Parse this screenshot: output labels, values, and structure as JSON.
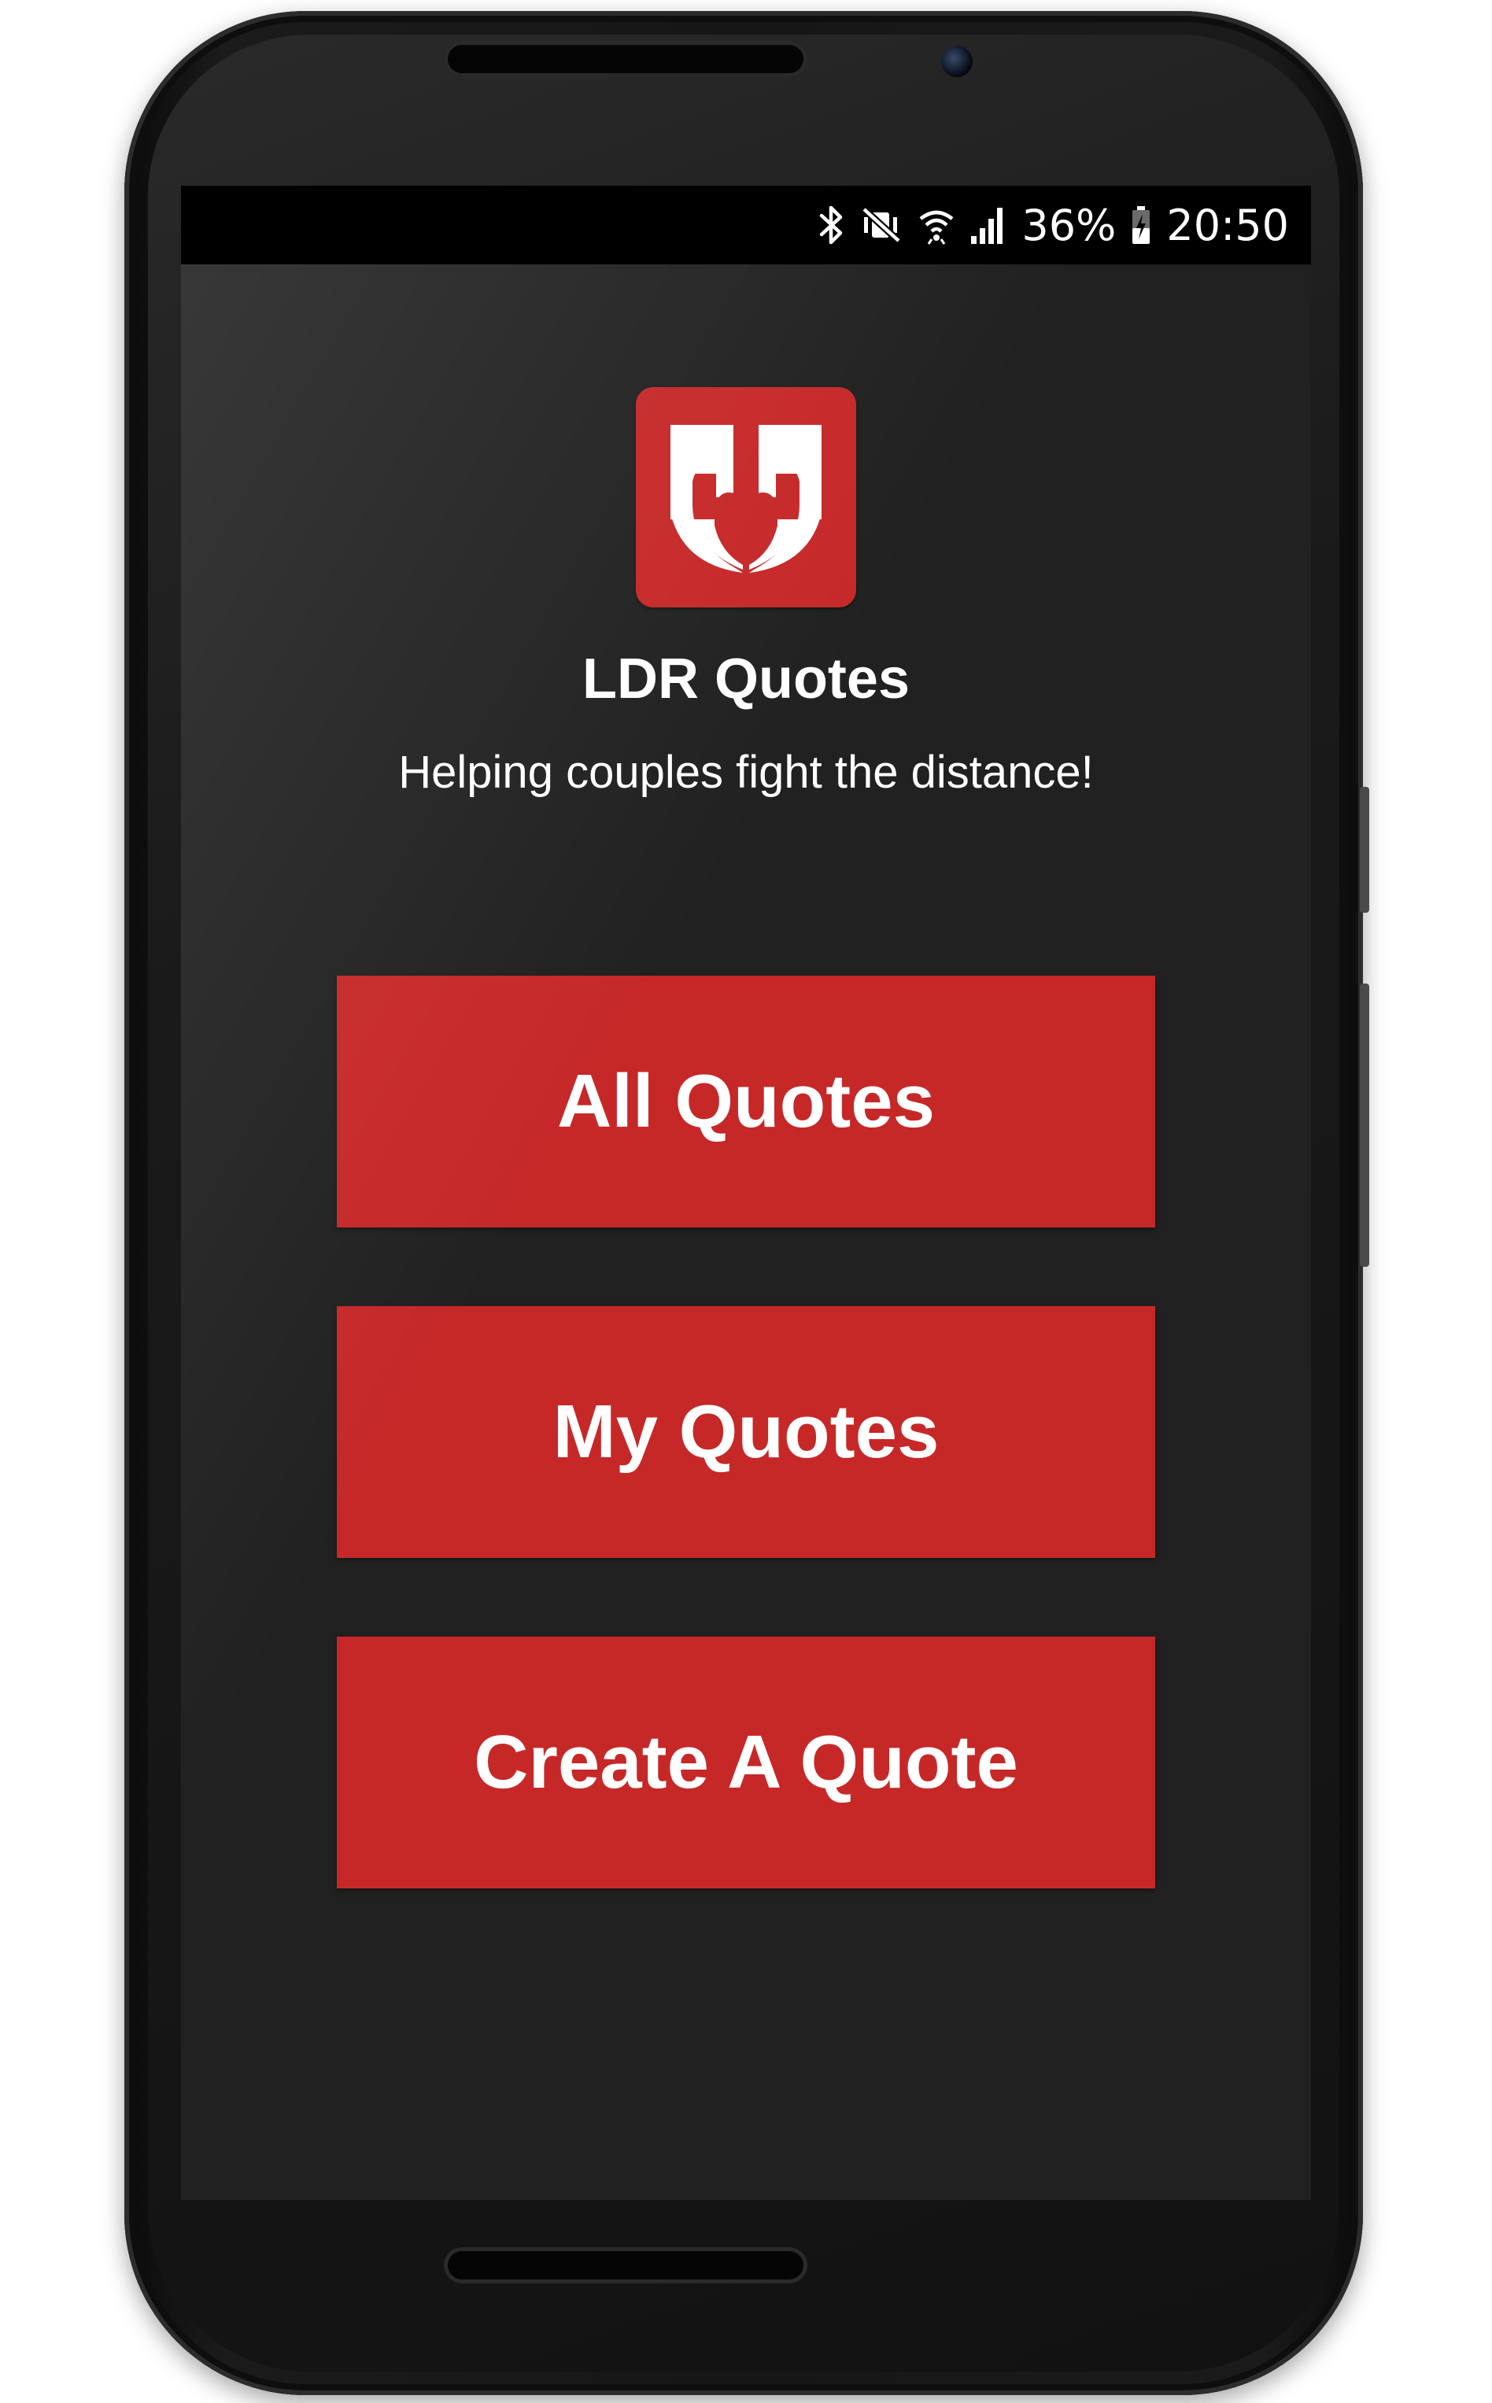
{
  "status_bar": {
    "battery_percent": "36%",
    "time": "20:50",
    "icons": [
      "bluetooth-icon",
      "vibrate-mute-icon",
      "wifi-icon",
      "signal-icon",
      "battery-charging-icon"
    ]
  },
  "app": {
    "title": "LDR Quotes",
    "tagline": "Helping couples fight the distance!",
    "logo_icon": "quote-heart-logo-icon"
  },
  "menu": {
    "all_quotes": "All Quotes",
    "my_quotes": "My Quotes",
    "create_quote": "Create A Quote"
  },
  "colors": {
    "accent": "#c62828",
    "background": "#212121",
    "status_bar": "#000000",
    "text": "#ffffff"
  }
}
